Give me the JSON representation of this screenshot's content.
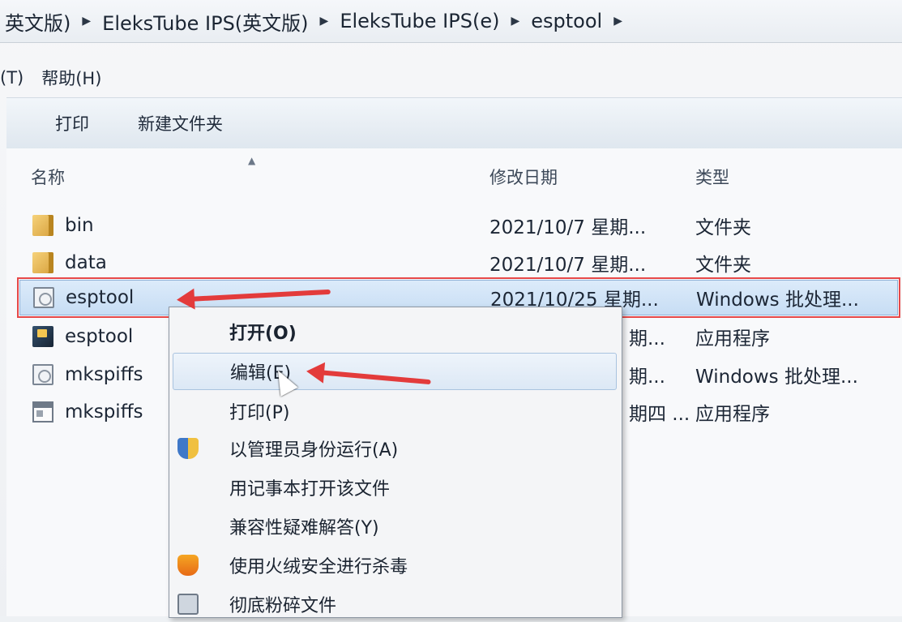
{
  "breadcrumb": [
    "英文版)",
    "EleksTube IPS(英文版)",
    "EleksTube IPS(e)",
    "esptool"
  ],
  "menubar": [
    "(T)",
    "帮助(H)"
  ],
  "toolbar": [
    "打印",
    "新建文件夹"
  ],
  "columns": {
    "name": "名称",
    "date": "修改日期",
    "type": "类型"
  },
  "files": [
    {
      "name": "bin",
      "date": "2021/10/7 星期...",
      "type": "文件夹",
      "icon": "folder-icon"
    },
    {
      "name": "data",
      "date": "2021/10/7 星期...",
      "type": "文件夹",
      "icon": "folder-icon"
    },
    {
      "name": "esptool",
      "date": "2021/10/25 星期...",
      "type": "Windows 批处理...",
      "icon": "batch-file-icon"
    },
    {
      "name": "esptool",
      "date": "期...",
      "type": "应用程序",
      "icon": "exe-icon"
    },
    {
      "name": "mkspiffs",
      "date": "期...",
      "type": "Windows 批处理...",
      "icon": "batch-file-icon"
    },
    {
      "name": "mkspiffs",
      "date": "期四 ...",
      "type": "应用程序",
      "icon": "application-icon"
    }
  ],
  "context_menu": [
    {
      "label": "打开(O)",
      "icon": ""
    },
    {
      "label": "编辑(E)",
      "icon": ""
    },
    {
      "label": "打印(P)",
      "icon": ""
    },
    {
      "label": "以管理员身份运行(A)",
      "icon": "uac-shield-icon"
    },
    {
      "label": "用记事本打开该文件",
      "icon": ""
    },
    {
      "label": "兼容性疑难解答(Y)",
      "icon": ""
    },
    {
      "label": "使用火绒安全进行杀毒",
      "icon": "huorong-icon"
    },
    {
      "label": "彻底粉碎文件",
      "icon": "shredder-icon"
    }
  ],
  "colors": {
    "annotation": "#e33b3b",
    "selection": "#c7ddf4"
  }
}
